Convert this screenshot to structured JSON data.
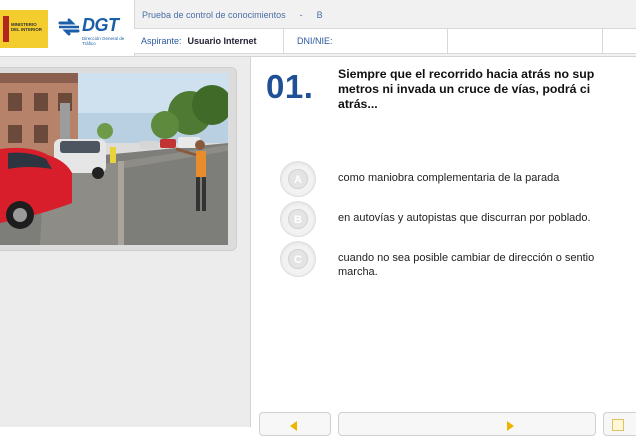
{
  "header": {
    "ministerio_text": "MINISTERIO\nDEL INTERIOR",
    "dgt_word": "DGT",
    "dgt_sub": "Dirección General de Tráfico",
    "breadcrumb_title": "Prueba de control de conocimientos",
    "breadcrumb_sep": "-",
    "breadcrumb_type": "B",
    "aspirante_label": "Aspirante:",
    "aspirante_value": "Usuario Internet",
    "dni_label": "DNI/NIE:",
    "dni_value": ""
  },
  "question": {
    "number": "01.",
    "text": "Siempre que el recorrido hacia atrás no sup\nmetros ni invada un cruce de vías, podrá ci\natrás..."
  },
  "answers": [
    {
      "letter": "A",
      "text": "como maniobra complementaria de la parada"
    },
    {
      "letter": "B",
      "text": "en autovías y autopistas que discurran por poblado."
    },
    {
      "letter": "C",
      "text": "cuando no sea posible cambiar de dirección o sentio\nmarcha."
    }
  ],
  "colors": {
    "accent_blue": "#1f4f95",
    "link_blue": "#4a6fa5",
    "nav_arrow": "#f0b400",
    "ministerio_yellow": "#f3cc2d"
  },
  "icons": {
    "prev": "arrow-left-icon",
    "next": "arrow-right-icon"
  }
}
